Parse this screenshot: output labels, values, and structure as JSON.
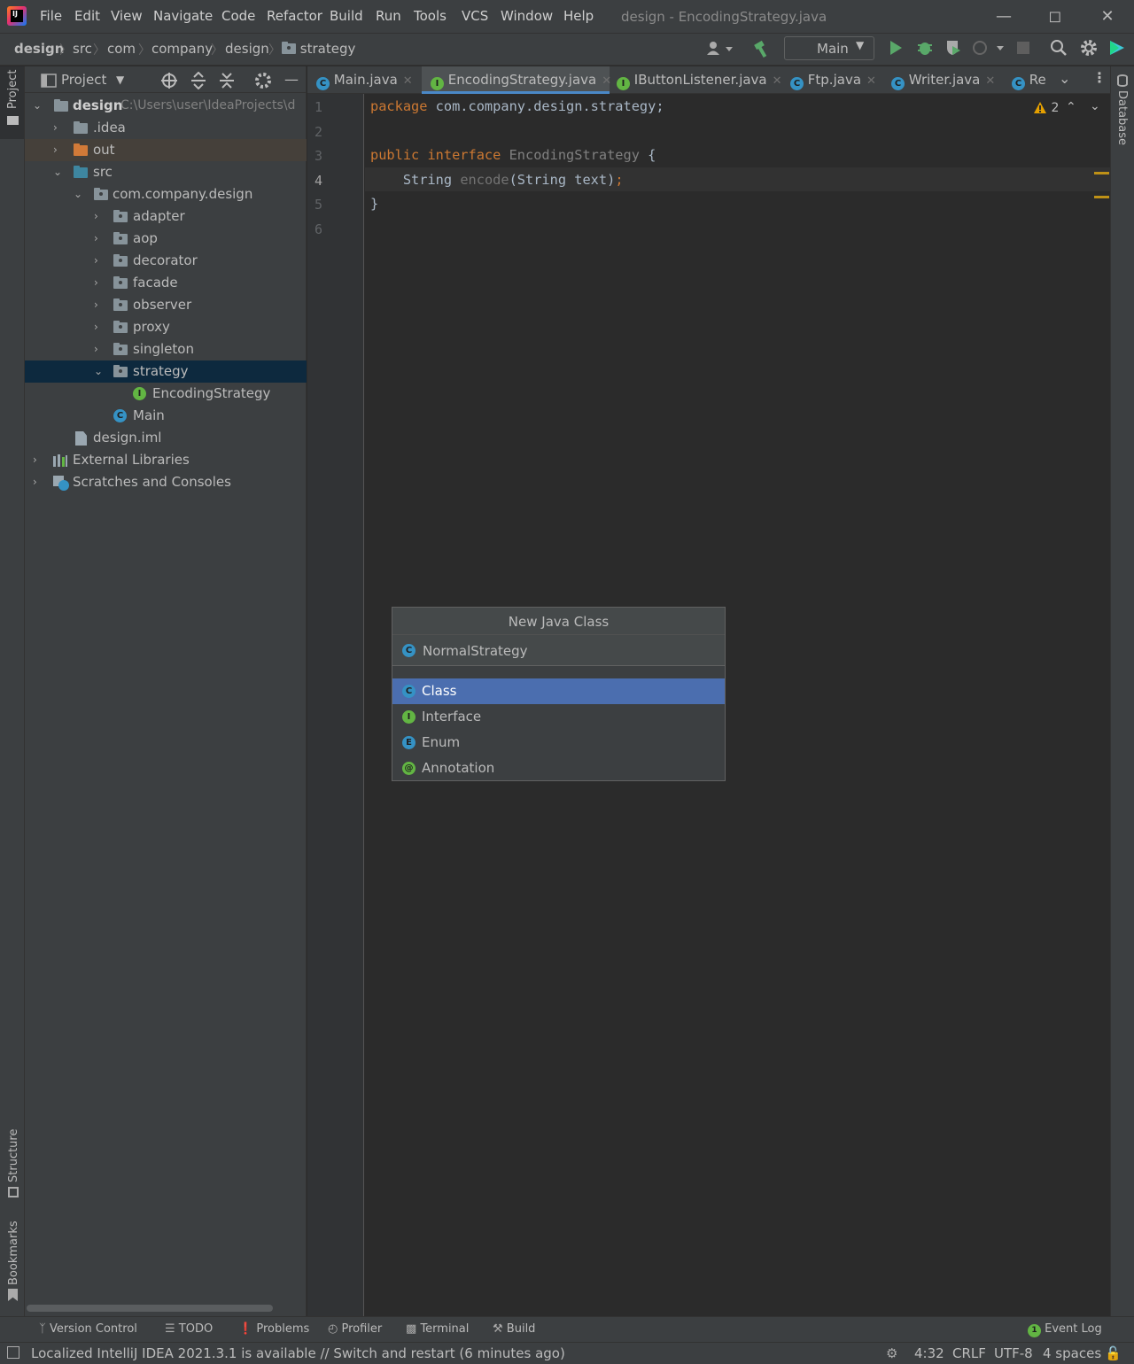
{
  "window": {
    "title": "design - EncodingStrategy.java",
    "menu": [
      "File",
      "Edit",
      "View",
      "Navigate",
      "Code",
      "Refactor",
      "Build",
      "Run",
      "Tools",
      "VCS",
      "Window",
      "Help"
    ]
  },
  "breadcrumb": [
    "design",
    "src",
    "com",
    "company",
    "design",
    "strategy"
  ],
  "toolbar": {
    "run_config": "Main"
  },
  "left_stripe": {
    "project": "Project",
    "structure": "Structure",
    "bookmarks": "Bookmarks"
  },
  "right_stripe": {
    "database": "Database"
  },
  "project_panel": {
    "title": "Project",
    "tree": [
      {
        "label": "design",
        "path": "C:\\Users\\user\\IdeaProjects\\d",
        "icon": "module-folder-icon"
      },
      {
        "label": ".idea",
        "icon": "folder-icon"
      },
      {
        "label": "out",
        "icon": "folder-orange-icon"
      },
      {
        "label": "src",
        "icon": "source-folder-icon"
      },
      {
        "label": "com.company.design",
        "icon": "package-icon"
      },
      {
        "label": "adapter",
        "icon": "package-icon"
      },
      {
        "label": "aop",
        "icon": "package-icon"
      },
      {
        "label": "decorator",
        "icon": "package-icon"
      },
      {
        "label": "facade",
        "icon": "package-icon"
      },
      {
        "label": "observer",
        "icon": "package-icon"
      },
      {
        "label": "proxy",
        "icon": "package-icon"
      },
      {
        "label": "singleton",
        "icon": "package-icon"
      },
      {
        "label": "strategy",
        "icon": "package-icon"
      },
      {
        "label": "EncodingStrategy",
        "icon": "interface-icon"
      },
      {
        "label": "Main",
        "icon": "class-icon"
      },
      {
        "label": "design.iml",
        "icon": "iml-file-icon"
      },
      {
        "label": "External Libraries",
        "icon": "libraries-icon"
      },
      {
        "label": "Scratches and Consoles",
        "icon": "scratches-icon"
      }
    ]
  },
  "tabs": [
    {
      "label": "Main.java",
      "badge": "C"
    },
    {
      "label": "EncodingStrategy.java",
      "badge": "I"
    },
    {
      "label": "IButtonListener.java",
      "badge": "I"
    },
    {
      "label": "Ftp.java",
      "badge": "C"
    },
    {
      "label": "Writer.java",
      "badge": "C"
    },
    {
      "label": "Re",
      "badge": "C"
    }
  ],
  "editor": {
    "line_numbers": [
      "1",
      "2",
      "3",
      "4",
      "5",
      "6"
    ],
    "warnings_count": "2",
    "code": {
      "l1_kw": "package",
      "l1_rest": " com.company.design.strategy;",
      "l3_kw": "public interface",
      "l3_name": " EncodingStrategy",
      "l3_rest": " {",
      "l4_type": "    String ",
      "l4_method": "encode",
      "l4_rest": "(String text)",
      "l4_semi": ";",
      "l5": "}"
    }
  },
  "popup": {
    "title": "New Java Class",
    "input_value": "NormalStrategy",
    "items": [
      {
        "label": "Class",
        "badge": "C"
      },
      {
        "label": "Interface",
        "badge": "I"
      },
      {
        "label": "Enum",
        "badge": "E"
      },
      {
        "label": "Annotation",
        "badge": "@"
      }
    ]
  },
  "toolwindows": [
    "Version Control",
    "TODO",
    "Problems",
    "Profiler",
    "Terminal",
    "Build",
    "Event Log"
  ],
  "event_log_count": "1",
  "status": {
    "message": "Localized IntelliJ IDEA 2021.3.1 is available // Switch and restart (6 minutes ago)",
    "position": "4:32",
    "line_separator": "CRLF",
    "encoding": "UTF-8",
    "indent": "4 spaces"
  },
  "colors": {
    "accent": "#4b6eaf",
    "keyword": "#cc7832",
    "selected_tree_row": "#0d293e",
    "class_badge": "#3592c4",
    "interface_badge": "#62b543",
    "run_green": "#59a869",
    "warning": "#e5a000"
  }
}
